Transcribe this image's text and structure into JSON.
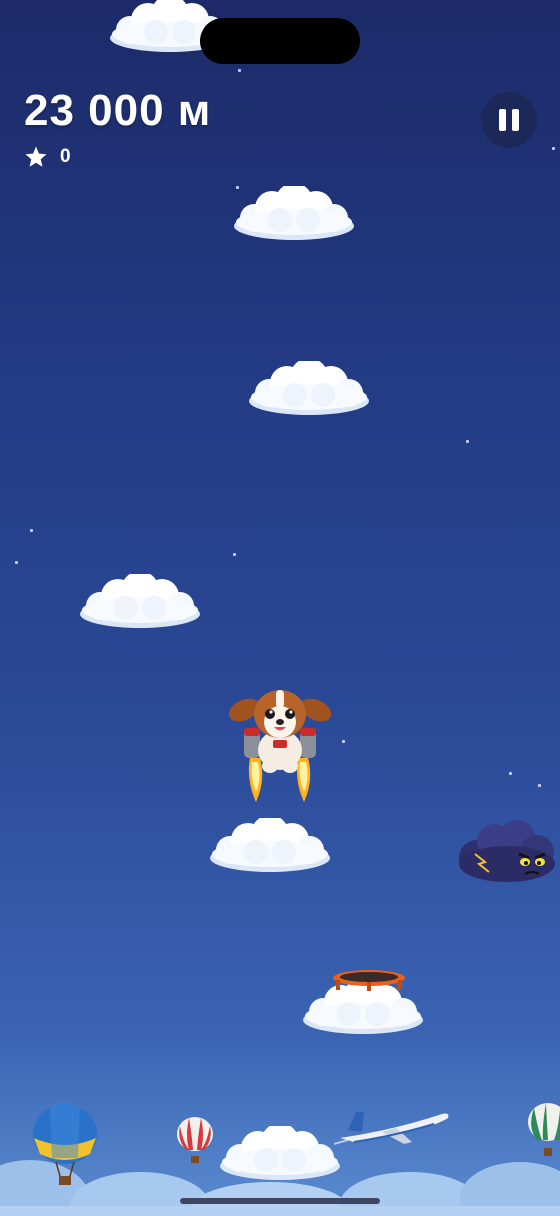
{
  "hud": {
    "altitude": "23 000 м",
    "stars_count": "0",
    "star_icon": "star-icon",
    "pause_icon": "pause-icon"
  },
  "game": {
    "player": "dog-with-jetpack",
    "hazard": "angry-storm-cloud",
    "powerup": "trampoline",
    "background_objects": [
      "hot-air-balloon-blue-yellow",
      "hot-air-balloon-red-white",
      "airplane",
      "hot-air-balloon-green"
    ]
  },
  "colors": {
    "sky_top": "#1c2a68",
    "sky_bottom": "#5a8bd0",
    "pause_button_bg": "#1b2859"
  }
}
